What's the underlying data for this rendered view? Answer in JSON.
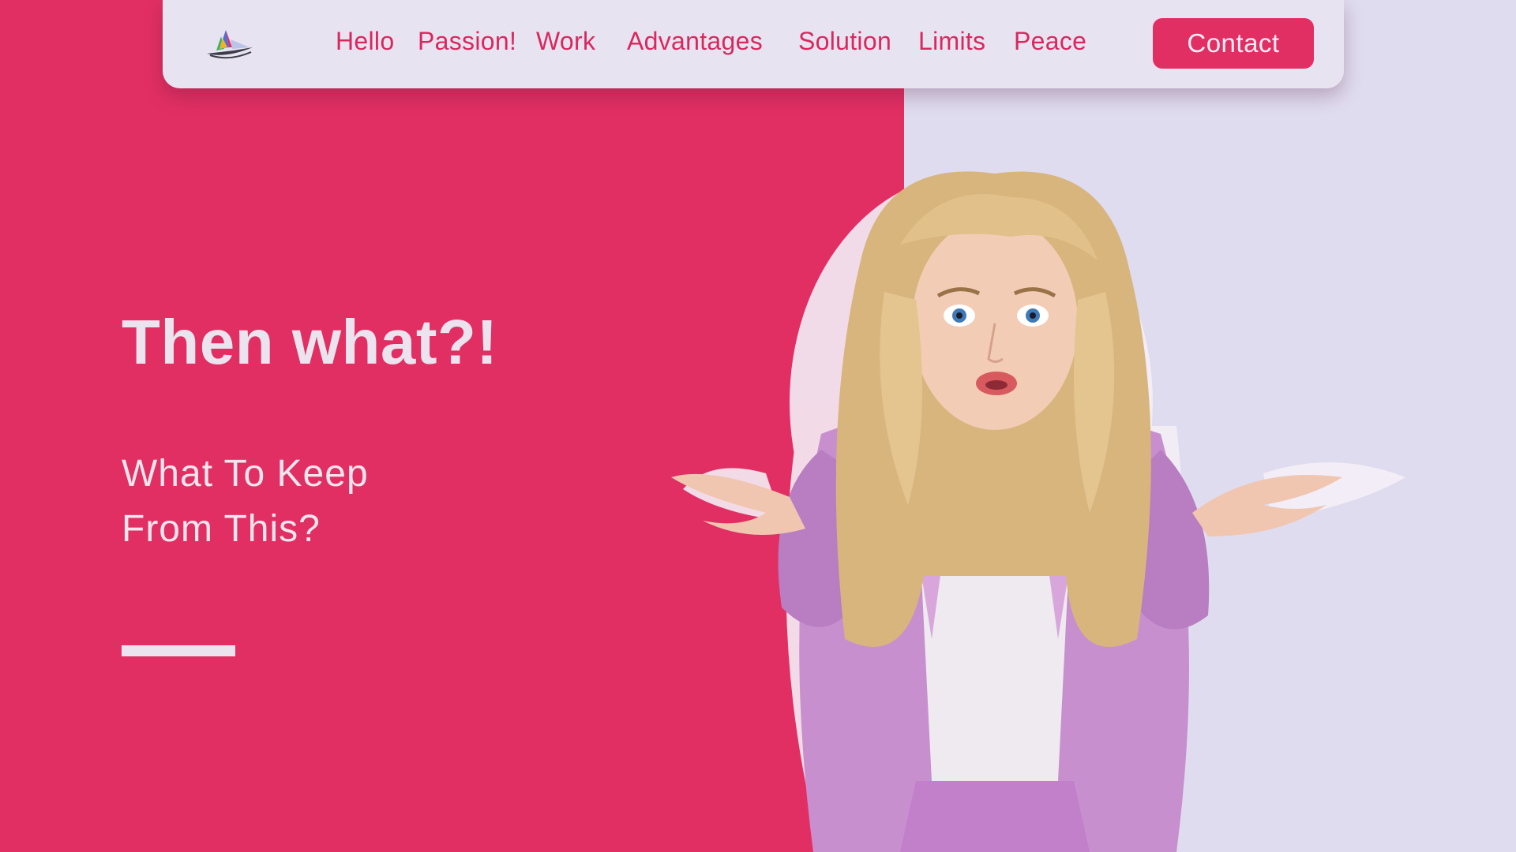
{
  "nav": {
    "logo_icon": "paper-boat-logo",
    "links": [
      {
        "label": "Hello"
      },
      {
        "label": "Passion!"
      },
      {
        "label": "Work"
      },
      {
        "label": "Advantages"
      },
      {
        "label": "Solution"
      },
      {
        "label": "Limits"
      },
      {
        "label": "Peace"
      }
    ],
    "contact_label": "Contact"
  },
  "hero": {
    "title": "Then what?!",
    "subtitle_line1": "What To Keep",
    "subtitle_line2": "From This?",
    "photo": "woman-shrugging-photo"
  },
  "colors": {
    "brand_pink": "#e22f63",
    "nav_background": "#e8e3f1",
    "page_lavender": "#e0dcf0",
    "hero_text": "#ebe4ee",
    "jacket_purple": "#c88fcf"
  }
}
